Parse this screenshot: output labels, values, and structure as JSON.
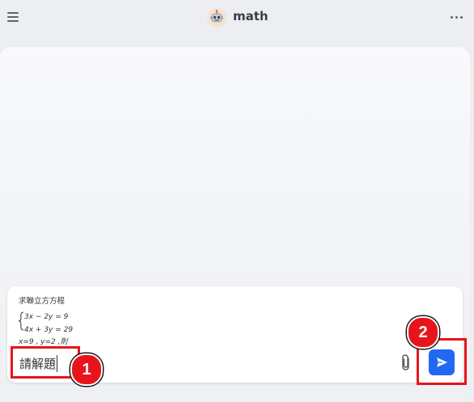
{
  "header": {
    "title": "math",
    "menu_icon": "hamburger-menu-icon",
    "avatar_icon": "robot-icon",
    "more_icon": "more-horizontal-icon"
  },
  "composer": {
    "input_value": "請解題",
    "attachment": {
      "line1": "求聯立方方程",
      "eq1": "3x − 2y = 9",
      "eq2": "4x + 3y = 29",
      "line4": "x=9 , y=2 ,則"
    },
    "attach_icon": "paperclip-icon",
    "send_icon": "send-arrow-icon"
  },
  "annotations": {
    "step1": "1",
    "step2": "2",
    "highlight_color": "#e8141c"
  },
  "colors": {
    "accent": "#2168f3",
    "background": "#eceef2"
  }
}
